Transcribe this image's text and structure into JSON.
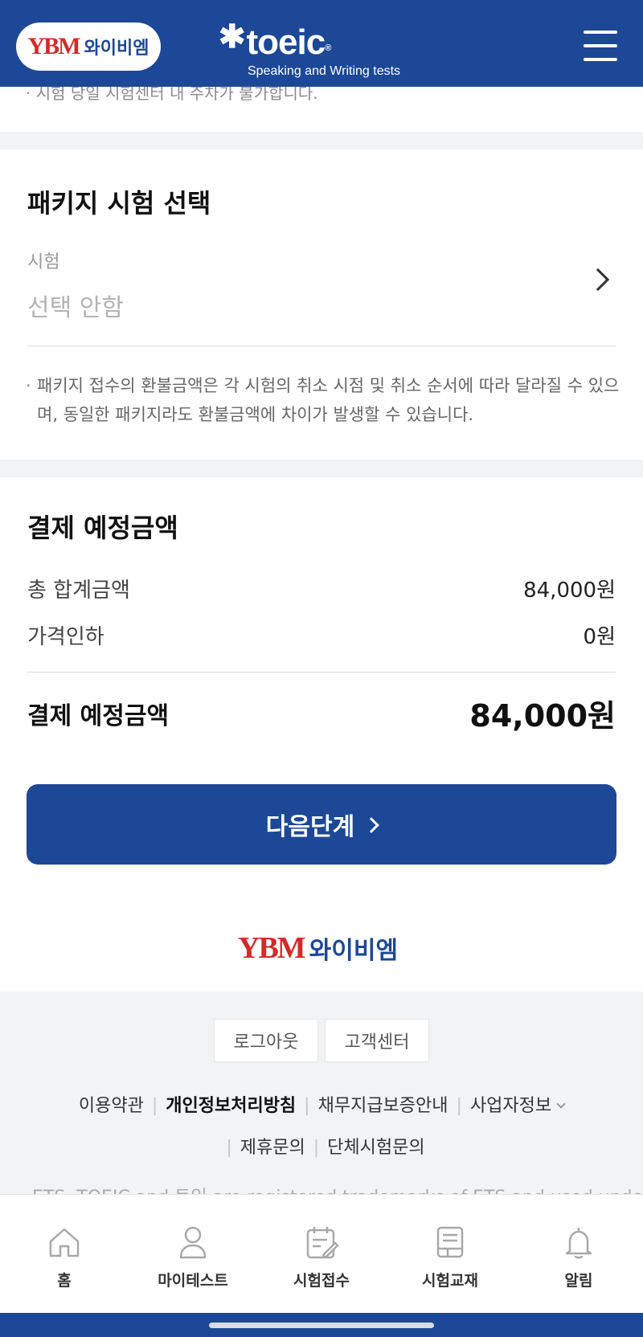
{
  "header": {
    "ybm_logo_mark": "YBM",
    "ybm_logo_text": "와이비엠",
    "toeic_logo_text": "toeic",
    "toeic_subtitle": "Speaking and Writing tests"
  },
  "clipped_notice": "· 시험 당일 시험센터 내 주차가 불가합니다.",
  "package_section": {
    "title": "패키지 시험 선택",
    "field_label": "시험",
    "field_value": "선택 안함",
    "notice": "패키지 접수의 환불금액은 각 시험의 취소 시점 및 취소 순서에 따라 달라질 수 있으며, 동일한 패키지라도 환불금액에 차이가 발생할 수 있습니다."
  },
  "payment_section": {
    "title": "결제 예정금액",
    "rows": [
      {
        "label": "총 합계금액",
        "value": "84,000원"
      },
      {
        "label": "가격인하",
        "value": "0원"
      }
    ],
    "total_label": "결제 예정금액",
    "total_value": "84,000원"
  },
  "next_button_label": "다음단계",
  "footer": {
    "logo_mark": "YBM",
    "logo_text": "와이비엠",
    "buttons": [
      "로그아웃",
      "고객센터"
    ],
    "links_row1": [
      "이용약관",
      "개인정보처리방침",
      "채무지급보증안내",
      "사업자정보"
    ],
    "links_row2": [
      "제휴문의",
      "단체시험문의"
    ],
    "trademark": "ETS, TOEIC and 토익 are registered trademarks of ETS and used under"
  },
  "bottom_nav": [
    {
      "label": "홈",
      "icon": "home-icon"
    },
    {
      "label": "마이테스트",
      "icon": "person-icon"
    },
    {
      "label": "시험접수",
      "icon": "calendar-edit-icon"
    },
    {
      "label": "시험교재",
      "icon": "book-icon"
    },
    {
      "label": "알림",
      "icon": "bell-icon"
    }
  ],
  "colors": {
    "brand_blue": "#1c4897",
    "ybm_red": "#d42a2a",
    "gray_bg": "#f2f3f5"
  }
}
